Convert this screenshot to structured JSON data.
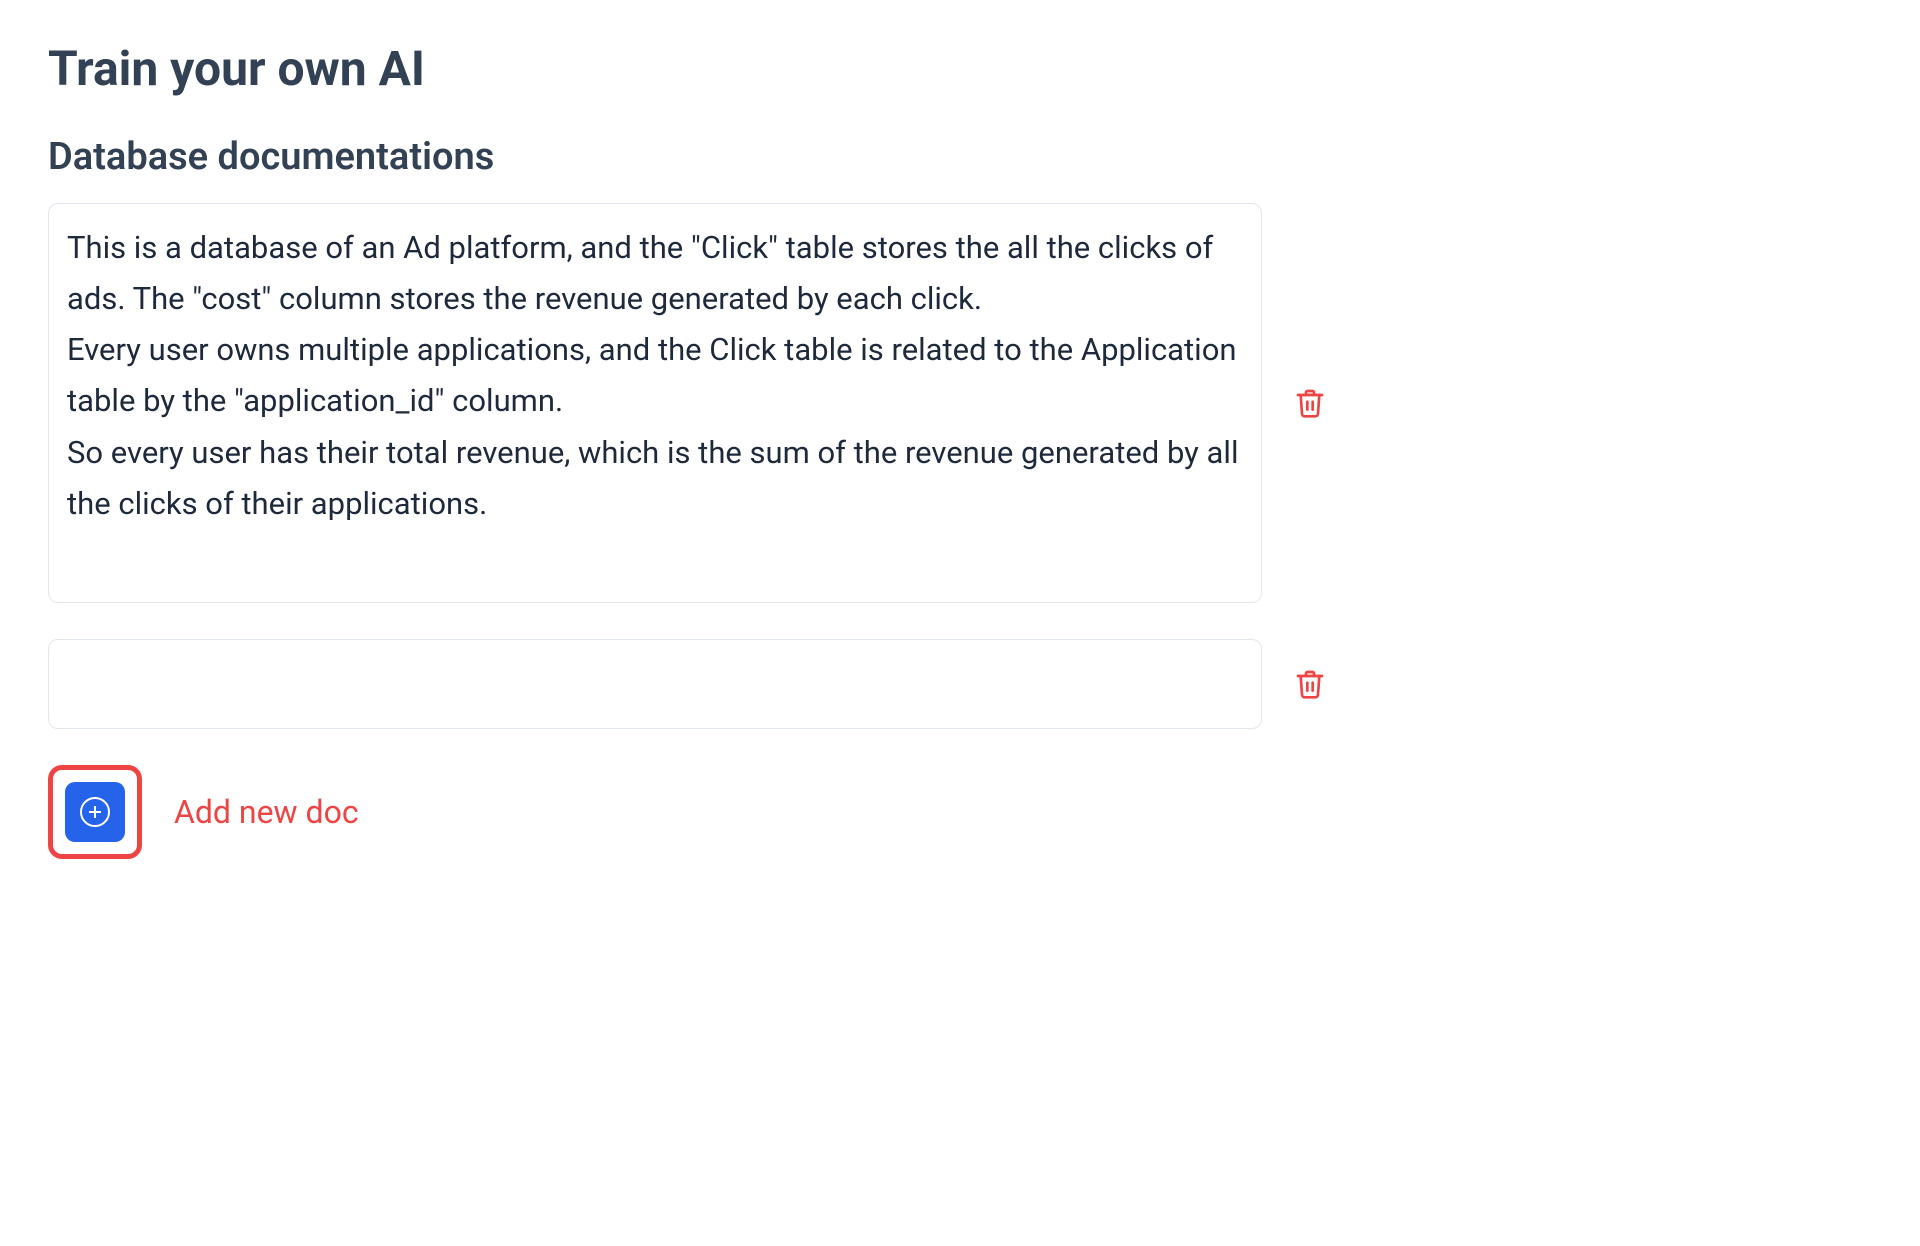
{
  "page_title": "Train your own AI",
  "section_title": "Database documentations",
  "docs": [
    {
      "content": "This is a database of an Ad platform, and the \"Click\" table stores the all the clicks of ads. The \"cost\" column stores the revenue generated by each click.\nEvery user owns multiple applications, and the Click table is related to the Application table by the \"application_id\" column.\nSo every user has their total revenue, which is the sum of the revenue generated by all the clicks of their applications."
    },
    {
      "content": ""
    }
  ],
  "add_label": "Add new doc",
  "colors": {
    "accent_red": "#ef4444",
    "accent_blue": "#2563eb",
    "text_dark": "#334155"
  }
}
